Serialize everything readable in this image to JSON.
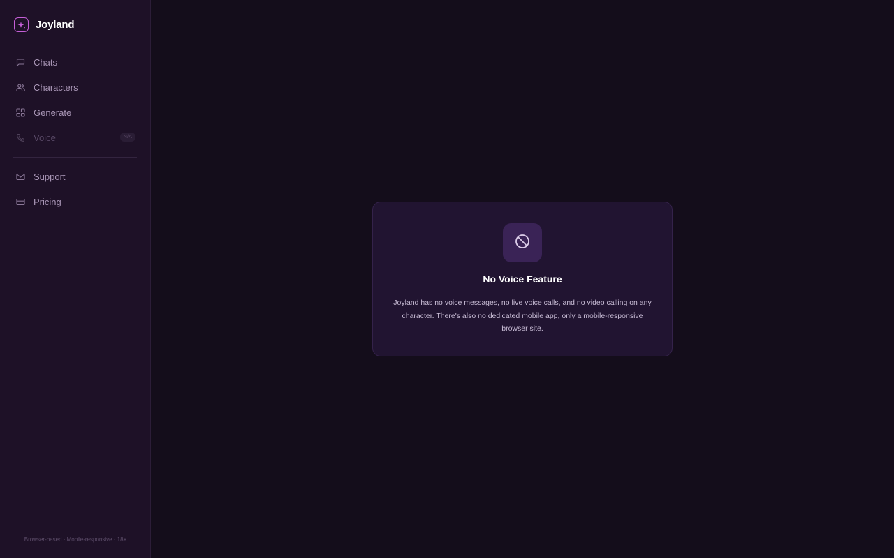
{
  "brand": {
    "name": "Joyland",
    "icon": "sparkle-icon"
  },
  "nav": {
    "items": [
      {
        "label": "Chats",
        "icon": "chat-bubble-icon"
      },
      {
        "label": "Characters",
        "icon": "users-icon"
      },
      {
        "label": "Generate",
        "icon": "grid-icon"
      },
      {
        "label": "Voice",
        "icon": "phone-icon",
        "badge": "N/A",
        "disabled": true
      }
    ],
    "secondary": [
      {
        "label": "Support",
        "icon": "mail-icon"
      },
      {
        "label": "Pricing",
        "icon": "credit-card-icon"
      }
    ]
  },
  "sidebar_footer": "Browser-based · Mobile-responsive · 18+",
  "notice": {
    "icon": "ban-icon",
    "title": "No Voice Feature",
    "text": "Joyland has no voice messages, no live voice calls, and no video calling on any character. There's also no dedicated mobile app, only a mobile-responsive browser site."
  },
  "colors": {
    "background": "#140d1b",
    "sidebar": "#1e1127",
    "accent": "#c45fd6",
    "card": "#211431",
    "icon_tile": "#3a2356"
  }
}
